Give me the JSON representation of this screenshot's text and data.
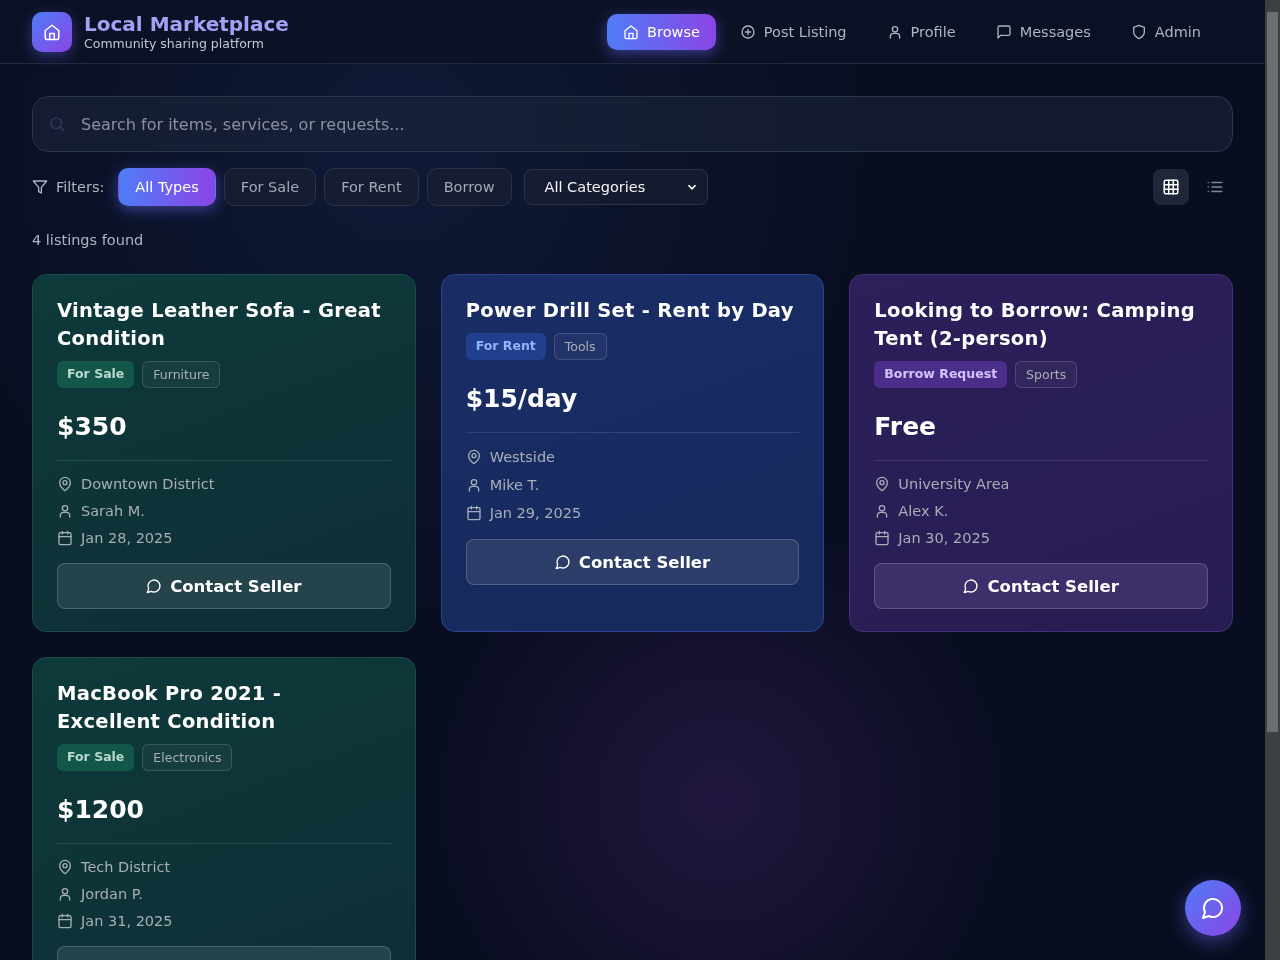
{
  "app": {
    "title": "Local Marketplace",
    "subtitle": "Community sharing platform"
  },
  "nav": [
    {
      "kind": "home",
      "label": "Browse",
      "selected": true
    },
    {
      "kind": "plus",
      "label": "Post Listing",
      "selected": false
    },
    {
      "kind": "user",
      "label": "Profile",
      "selected": false
    },
    {
      "kind": "chat",
      "label": "Messages",
      "selected": false
    },
    {
      "kind": "shield",
      "label": "Admin",
      "selected": false
    }
  ],
  "search": {
    "placeholder": "Search for items, services, or requests..."
  },
  "filters": {
    "label": "Filters:",
    "types": [
      {
        "label": "All Types",
        "selected": true
      },
      {
        "label": "For Sale",
        "selected": false
      },
      {
        "label": "For Rent",
        "selected": false
      },
      {
        "label": "Borrow",
        "selected": false
      }
    ],
    "category": "All Categories"
  },
  "view_toggle": [
    {
      "kind": "grid",
      "selected": true
    },
    {
      "kind": "list",
      "selected": false
    }
  ],
  "result_count": "4 listings found",
  "listings": [
    {
      "title": "Vintage Leather Sofa - Great Condition",
      "kind": "sale",
      "type_label": "For Sale",
      "category": "Furniture",
      "price": "$350",
      "location": "Downtown District",
      "seller": "Sarah M.",
      "date": "Jan 28, 2025",
      "action": "Contact Seller"
    },
    {
      "title": "Power Drill Set - Rent by Day",
      "kind": "rent",
      "type_label": "For Rent",
      "category": "Tools",
      "price": "$15/day",
      "location": "Westside",
      "seller": "Mike T.",
      "date": "Jan 29, 2025",
      "action": "Contact Seller"
    },
    {
      "title": "Looking to Borrow: Camping Tent (2-person)",
      "kind": "borrow",
      "type_label": "Borrow Request",
      "category": "Sports",
      "price": "Free",
      "location": "University Area",
      "seller": "Alex K.",
      "date": "Jan 30, 2025",
      "action": "Contact Seller"
    },
    {
      "title": "MacBook Pro 2021 - Excellent Condition",
      "kind": "sale",
      "type_label": "For Sale",
      "category": "Electronics",
      "price": "$1200",
      "location": "Tech District",
      "seller": "Jordan P.",
      "date": "Jan 31, 2025"
    }
  ]
}
